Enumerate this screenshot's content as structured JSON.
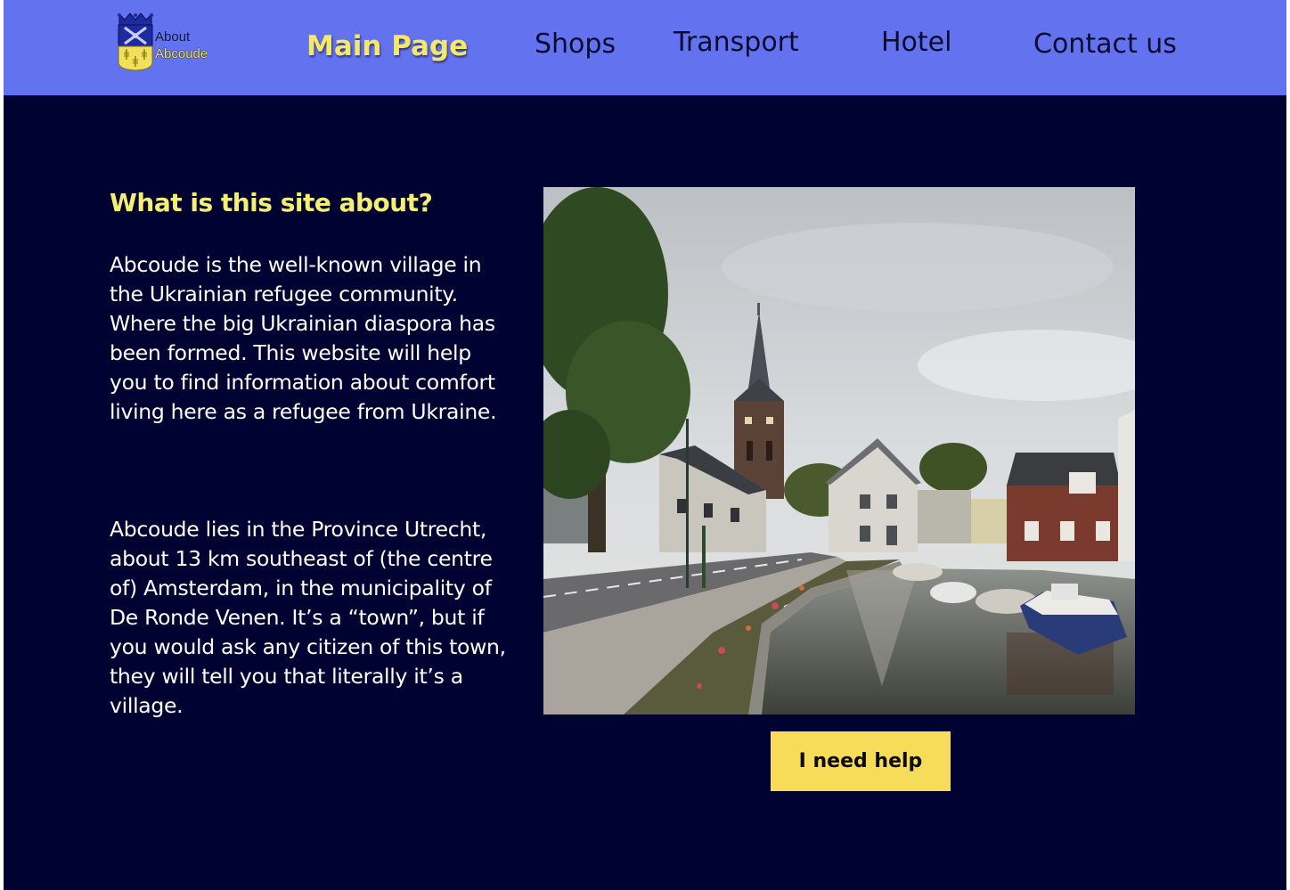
{
  "header": {
    "logo": {
      "line1": "About",
      "line2": "Abcoude",
      "icon": "coat-of-arms-icon",
      "colors": {
        "top": "#1e2aa0",
        "bottom": "#f0e05a"
      }
    },
    "nav": {
      "main": "Main Page",
      "shops": "Shops",
      "transport": "Transport",
      "hotel": "Hotel",
      "contact": "Contact us"
    },
    "active_item": "Main Page"
  },
  "main": {
    "heading": "What is this site about?",
    "paragraph1": "Abcoude is the well-known village in the Ukrainian refugee community. Where the big Ukrainian diaspora has been formed. This website will help you to find information about comfort living here as a refugee from Ukraine.",
    "paragraph2": "Abcoude lies in the Province Utrecht, about 13 km southeast of (the centre of) Amsterdam, in the municipality of De Ronde Venen. It’s a “town”, but if you would ask any citizen of this town, they will tell you that literally it’s a village.",
    "photo": "village-canal-church-photo",
    "help_button": "I need help"
  },
  "colors": {
    "header_bg": "#6373f0",
    "page_bg": "#000332",
    "accent_yellow": "#f4ef72",
    "button_bg": "#f7dc5a",
    "nav_text": "#0a0d2e"
  }
}
